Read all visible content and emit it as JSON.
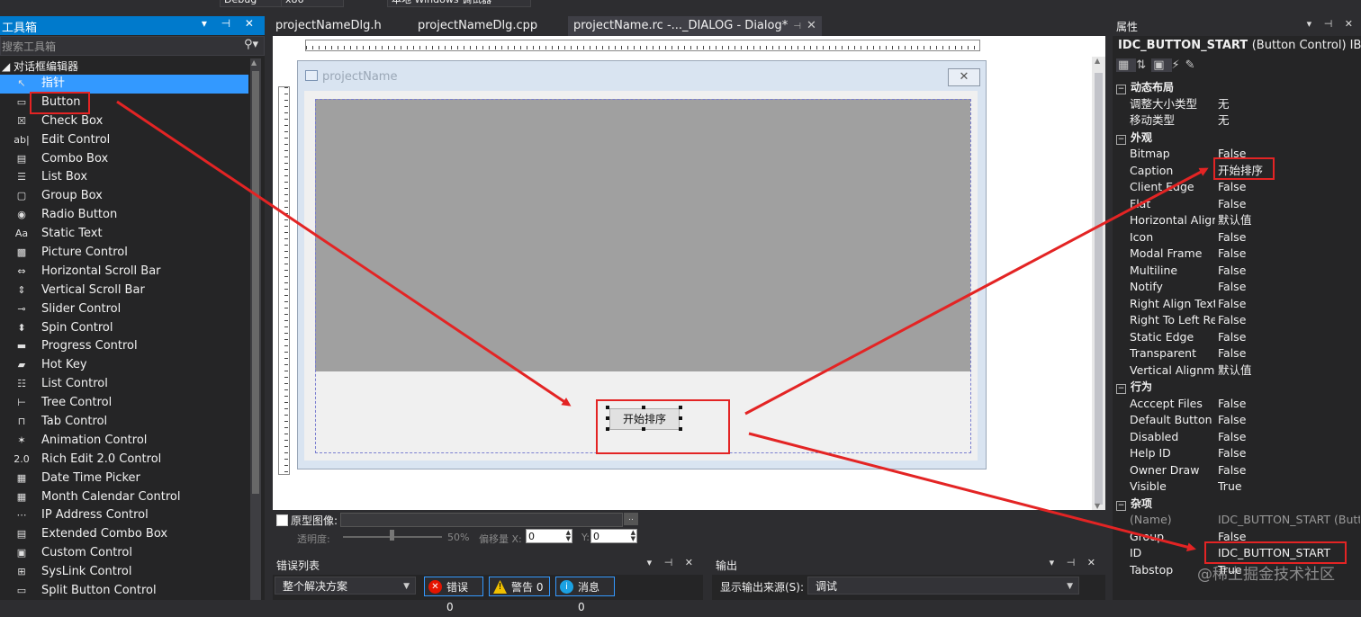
{
  "toolbar": {
    "config": "Debug",
    "platform": "x86",
    "run_label": "本地 Windows 调试器"
  },
  "toolbox": {
    "title": "工具箱",
    "header_buttons": "▾ ⊣ ✕",
    "search_placeholder": "搜索工具箱",
    "group": "对话框编辑器",
    "items": [
      {
        "label": "指针",
        "icon": "↖"
      },
      {
        "label": "Button",
        "icon": "▭"
      },
      {
        "label": "Check Box",
        "icon": "☒"
      },
      {
        "label": "Edit Control",
        "icon": "ab|"
      },
      {
        "label": "Combo Box",
        "icon": "▤"
      },
      {
        "label": "List Box",
        "icon": "☰"
      },
      {
        "label": "Group Box",
        "icon": "▢"
      },
      {
        "label": "Radio Button",
        "icon": "◉"
      },
      {
        "label": "Static Text",
        "icon": "Aa"
      },
      {
        "label": "Picture Control",
        "icon": "▩"
      },
      {
        "label": "Horizontal Scroll Bar",
        "icon": "⇔"
      },
      {
        "label": "Vertical Scroll Bar",
        "icon": "⇕"
      },
      {
        "label": "Slider Control",
        "icon": "⊸"
      },
      {
        "label": "Spin Control",
        "icon": "⬍"
      },
      {
        "label": "Progress Control",
        "icon": "▬"
      },
      {
        "label": "Hot Key",
        "icon": "▰"
      },
      {
        "label": "List Control",
        "icon": "☷"
      },
      {
        "label": "Tree Control",
        "icon": "⊢"
      },
      {
        "label": "Tab Control",
        "icon": "⊓"
      },
      {
        "label": "Animation Control",
        "icon": "✶"
      },
      {
        "label": "Rich Edit 2.0 Control",
        "icon": "2.0"
      },
      {
        "label": "Date Time Picker",
        "icon": "▦"
      },
      {
        "label": "Month Calendar Control",
        "icon": "▦"
      },
      {
        "label": "IP Address Control",
        "icon": "⋯"
      },
      {
        "label": "Extended Combo Box",
        "icon": "▤"
      },
      {
        "label": "Custom Control",
        "icon": "▣"
      },
      {
        "label": "SysLink Control",
        "icon": "⊞"
      },
      {
        "label": "Split Button Control",
        "icon": "▭"
      }
    ]
  },
  "tabs": [
    {
      "label": "projectNameDlg.h"
    },
    {
      "label": "projectNameDlg.cpp"
    },
    {
      "label": "projectName.rc -..._DIALOG - Dialog*"
    }
  ],
  "dialog": {
    "title": "projectName",
    "close": "✕",
    "button_caption": "开始排序"
  },
  "prototype": {
    "label": "原型图像:",
    "browse": "..",
    "opacity_label": "透明度:",
    "opacity": "50%",
    "offset_label": "偏移量 X:",
    "x": "0",
    "y_label": "Y:",
    "y": "0"
  },
  "error_list": {
    "title": "错误列表",
    "buttons": "▾ ⊣ ✕",
    "scope": "整个解决方案",
    "errors": "错误 0",
    "warnings": "警告 0",
    "messages": "消息 0"
  },
  "output": {
    "title": "输出",
    "buttons": "▾ ⊣ ✕",
    "source_label": "显示输出来源(S):",
    "source": "调试"
  },
  "properties": {
    "title": "属性",
    "buttons": "▾ ⊣ ✕",
    "object": "IDC_BUTTON_START",
    "object_type": "(Button Control)  IBu",
    "categories": [
      {
        "name": "动态布局",
        "rows": [
          {
            "name": "调整大小类型",
            "value": "无"
          },
          {
            "name": "移动类型",
            "value": "无"
          }
        ]
      },
      {
        "name": "外观",
        "rows": [
          {
            "name": "Bitmap",
            "value": "False"
          },
          {
            "name": "Caption",
            "value": "开始排序"
          },
          {
            "name": "Client Edge",
            "value": "False"
          },
          {
            "name": "Flat",
            "value": "False"
          },
          {
            "name": "Horizontal Align",
            "value": "默认值"
          },
          {
            "name": "Icon",
            "value": "False"
          },
          {
            "name": "Modal Frame",
            "value": "False"
          },
          {
            "name": "Multiline",
            "value": "False"
          },
          {
            "name": "Notify",
            "value": "False"
          },
          {
            "name": "Right Align Text",
            "value": "False"
          },
          {
            "name": "Right To Left Re",
            "value": "False"
          },
          {
            "name": "Static Edge",
            "value": "False"
          },
          {
            "name": "Transparent",
            "value": "False"
          },
          {
            "name": "Vertical Alignme",
            "value": "默认值"
          }
        ]
      },
      {
        "name": "行为",
        "rows": [
          {
            "name": "Acccept Files",
            "value": "False"
          },
          {
            "name": "Default Button",
            "value": "False"
          },
          {
            "name": "Disabled",
            "value": "False"
          },
          {
            "name": "Help ID",
            "value": "False"
          },
          {
            "name": "Owner Draw",
            "value": "False"
          },
          {
            "name": "Visible",
            "value": "True"
          }
        ]
      },
      {
        "name": "杂项",
        "rows": [
          {
            "name": "(Name)",
            "value": "IDC_BUTTON_START (Butt",
            "dim": true
          },
          {
            "name": "Group",
            "value": "False"
          },
          {
            "name": "ID",
            "value": "IDC_BUTTON_START"
          },
          {
            "name": "Tabstop",
            "value": "True"
          }
        ]
      }
    ]
  },
  "watermark": "@稀土掘金技术社区",
  "colors": {
    "accent": "#007acc",
    "selection": "#3399ff",
    "annotation": "#e32424"
  }
}
